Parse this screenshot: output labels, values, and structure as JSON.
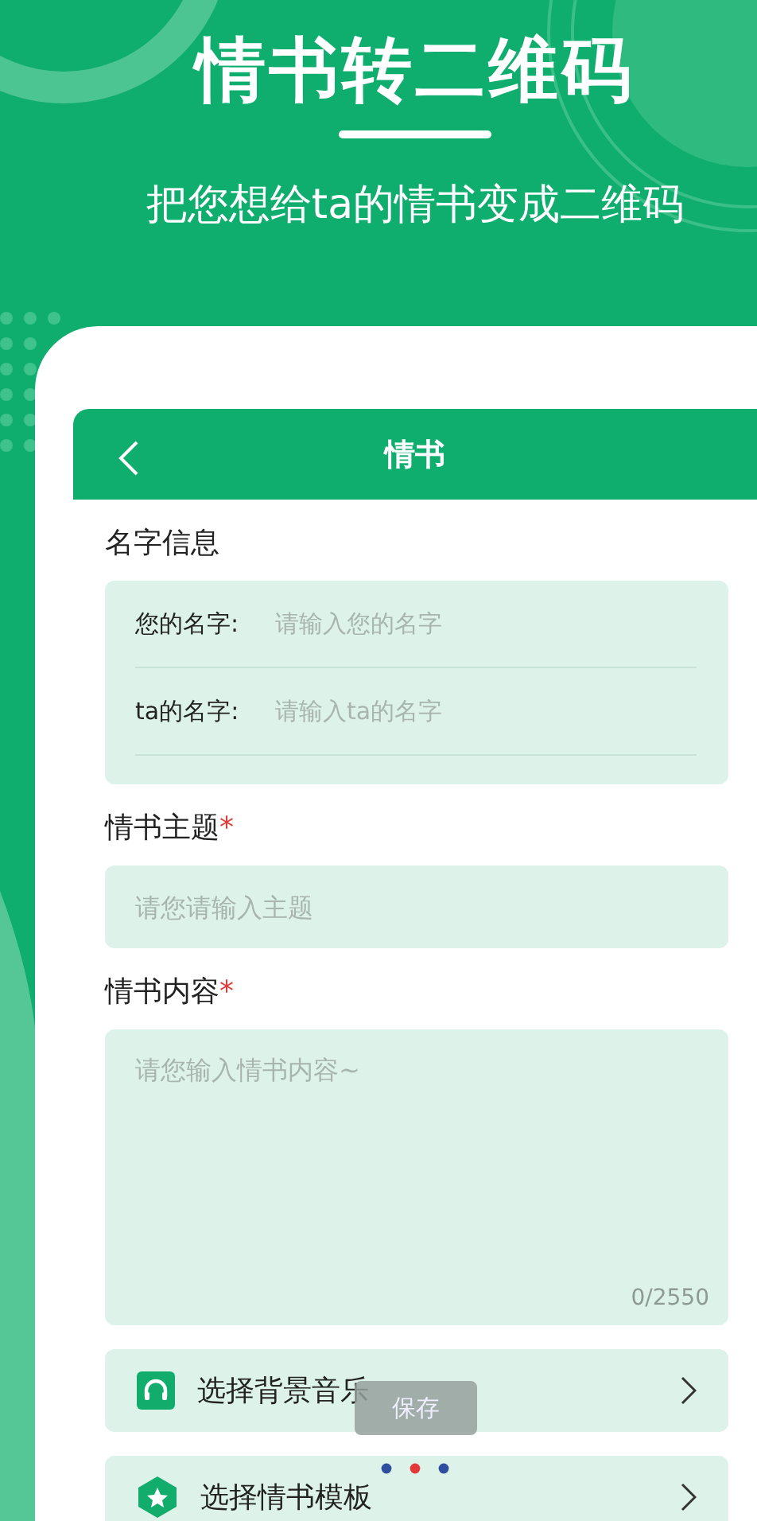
{
  "hero": {
    "title": "情书转二维码",
    "subtitle": "把您想给ta的情书变成二维码"
  },
  "screen": {
    "title": "情书"
  },
  "name_section": {
    "heading": "名字信息",
    "rows": [
      {
        "label": "您的名字:",
        "placeholder": "请输入您的名字"
      },
      {
        "label": "ta的名字:",
        "placeholder": "请输入ta的名字"
      }
    ]
  },
  "subject": {
    "heading": "情书主题",
    "required_mark": "*",
    "placeholder": "请您请输入主题"
  },
  "content": {
    "heading": "情书内容",
    "required_mark": "*",
    "placeholder": "请您输入情书内容~",
    "counter": "0/2550"
  },
  "options": [
    {
      "label": "选择背景音乐",
      "kind": "music"
    },
    {
      "label": "选择情书模板",
      "kind": "template"
    }
  ],
  "toast": {
    "text": "保存"
  }
}
